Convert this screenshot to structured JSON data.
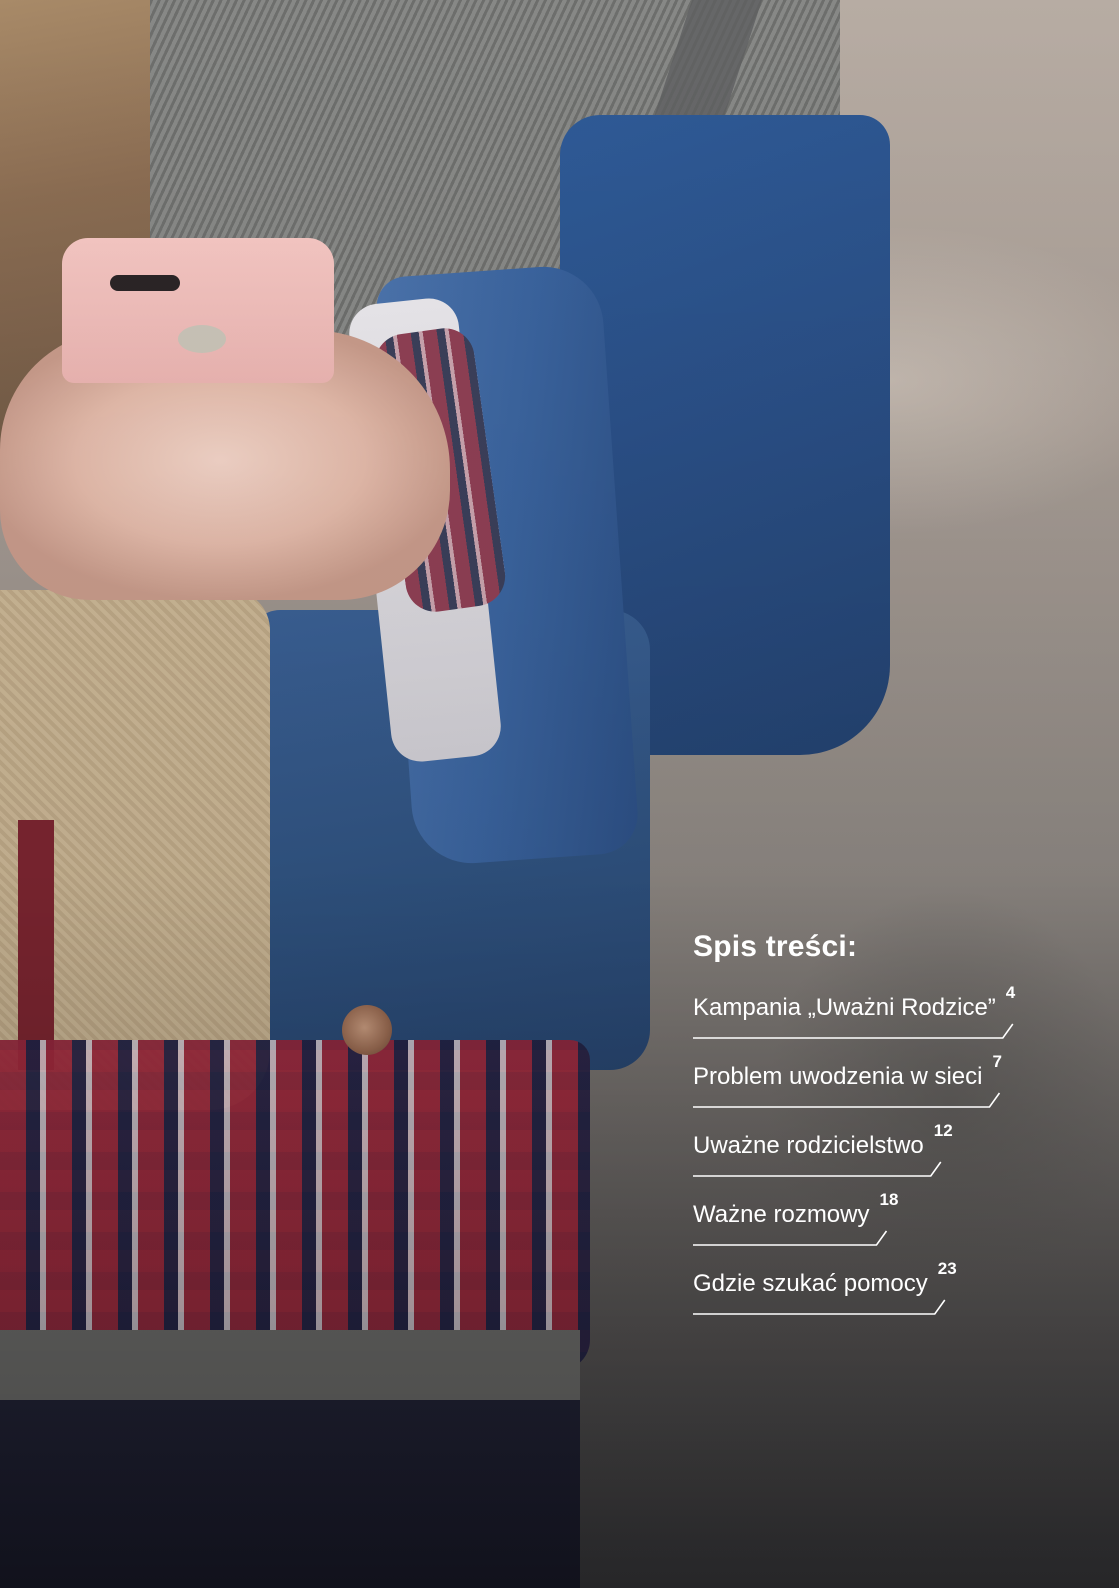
{
  "toc": {
    "title": "Spis treści:",
    "items": [
      {
        "label": "Kampania „Uważni Rodzice”",
        "page": "4"
      },
      {
        "label": "Problem uwodzenia w sieci",
        "page": "7"
      },
      {
        "label": "Uważne rodzicielstwo",
        "page": "12"
      },
      {
        "label": "Ważne rozmowy",
        "page": "18"
      },
      {
        "label": "Gdzie szukać pomocy",
        "page": "23"
      }
    ]
  },
  "colors": {
    "text": "#ffffff",
    "denim": "#2f527f",
    "phone": "#f4c6c2"
  }
}
